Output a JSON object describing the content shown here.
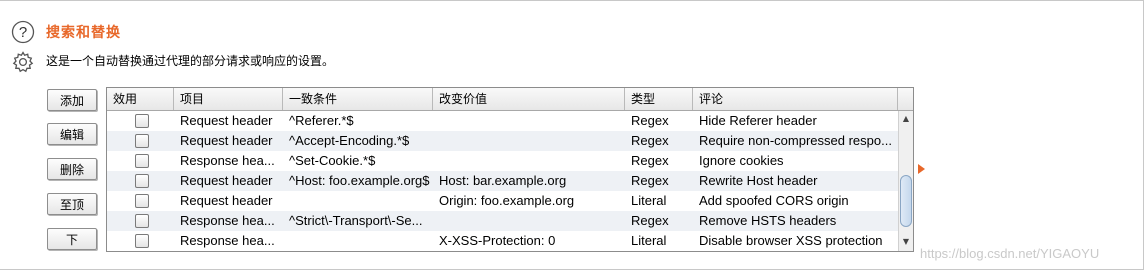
{
  "panel": {
    "title": "搜索和替换",
    "description": "这是一个自动替换通过代理的部分请求或响应的设置。"
  },
  "buttons": {
    "add": "添加",
    "edit": "编辑",
    "remove": "删除",
    "top": "至顶",
    "down": "下"
  },
  "table": {
    "columns": [
      "效用",
      "项目",
      "一致条件",
      "改变价值",
      "类型",
      "评论"
    ],
    "rows": [
      {
        "enabled": false,
        "item": "Request header",
        "match": "^Referer.*$",
        "replace": "",
        "type": "Regex",
        "comment": "Hide Referer header"
      },
      {
        "enabled": false,
        "item": "Request header",
        "match": "^Accept-Encoding.*$",
        "replace": "",
        "type": "Regex",
        "comment": "Require non-compressed respo..."
      },
      {
        "enabled": false,
        "item": "Response hea...",
        "match": "^Set-Cookie.*$",
        "replace": "",
        "type": "Regex",
        "comment": "Ignore cookies"
      },
      {
        "enabled": false,
        "item": "Request header",
        "match": "^Host: foo.example.org$",
        "replace": "Host: bar.example.org",
        "type": "Regex",
        "comment": "Rewrite Host header"
      },
      {
        "enabled": false,
        "item": "Request header",
        "match": "",
        "replace": "Origin: foo.example.org",
        "type": "Literal",
        "comment": "Add spoofed CORS origin"
      },
      {
        "enabled": false,
        "item": "Response hea...",
        "match": "^Strict\\-Transport\\-Se...",
        "replace": "",
        "type": "Regex",
        "comment": "Remove HSTS headers"
      },
      {
        "enabled": false,
        "item": "Response hea...",
        "match": "",
        "replace": "X-XSS-Protection: 0",
        "type": "Literal",
        "comment": "Disable browser XSS protection"
      }
    ]
  },
  "icons": {
    "help": "help-icon",
    "settings": "gear-icon",
    "scroll_up": "scroll-up-arrow-icon",
    "scroll_down": "scroll-down-arrow-icon",
    "marker": "orange-triangle-marker-icon"
  },
  "colors": {
    "title": "#e8682a",
    "row_alt": "#eef1f5",
    "scroll_thumb": "#c4d7ec"
  },
  "watermark": "https://blog.csdn.net/YIGAOYU"
}
